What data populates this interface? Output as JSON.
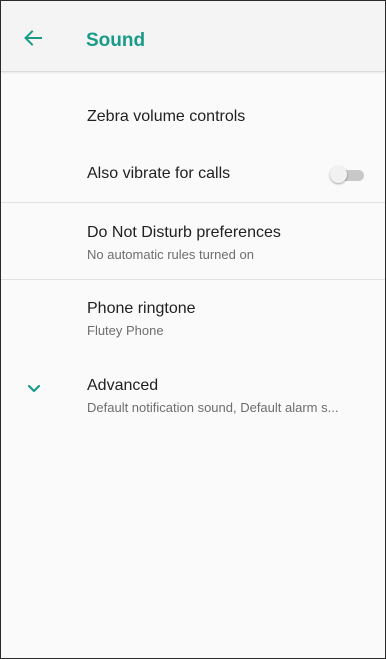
{
  "app_bar": {
    "title": "Sound",
    "back_icon": "arrow-back-icon"
  },
  "colors": {
    "accent": "#1a9b8a",
    "primary_text": "#212121",
    "secondary_text": "#6e6e6e",
    "toggle_off_track": "#c8c8c8",
    "toggle_off_thumb": "#f1f1f1"
  },
  "settings": {
    "volume_controls": {
      "title": "Zebra volume controls"
    },
    "vibrate_for_calls": {
      "title": "Also vibrate for calls",
      "toggle_state": "off"
    },
    "do_not_disturb": {
      "title": "Do Not Disturb preferences",
      "summary": "No automatic rules turned on"
    },
    "phone_ringtone": {
      "title": "Phone ringtone",
      "summary": "Flutey Phone"
    },
    "advanced": {
      "title": "Advanced",
      "summary": "Default notification sound, Default alarm s...",
      "expand_icon": "chevron-down-icon"
    }
  }
}
